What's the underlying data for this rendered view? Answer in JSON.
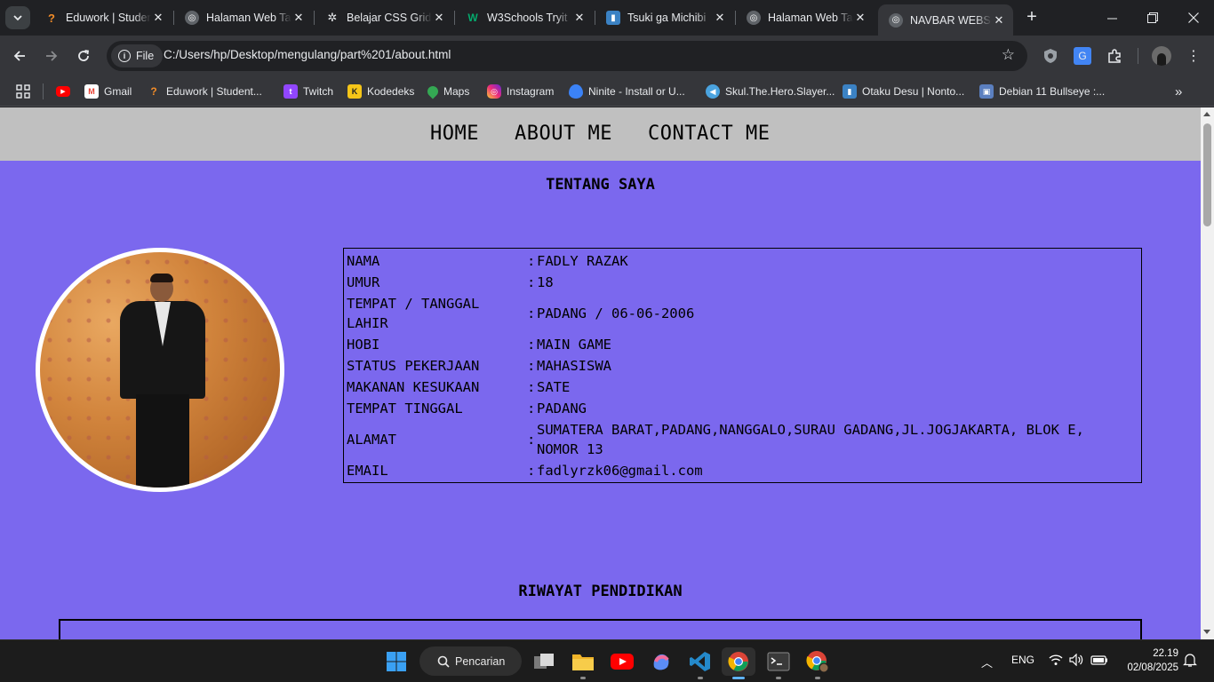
{
  "browser": {
    "tabs": [
      {
        "title": "Eduwork | Student",
        "favicon": "eduwork-icon",
        "active": false
      },
      {
        "title": "Halaman Web Ta",
        "favicon": "globe-icon",
        "active": false
      },
      {
        "title": "Belajar CSS Grid",
        "favicon": "openai-icon",
        "active": false
      },
      {
        "title": "W3Schools Tryit",
        "favicon": "w3schools-icon",
        "active": false
      },
      {
        "title": "Tsuki ga Michibi",
        "favicon": "bookmark-page-icon",
        "active": false
      },
      {
        "title": "Halaman Web Ta",
        "favicon": "globe-icon",
        "active": false
      },
      {
        "title": "NAVBAR WEBSITE",
        "favicon": "globe-icon",
        "active": true
      }
    ],
    "file_chip": "File",
    "url": "C:/Users/hp/Desktop/mengulang/part%201/about.html",
    "bookmarks": [
      {
        "label": "",
        "icon": "youtube-icon"
      },
      {
        "label": "Gmail",
        "icon": "gmail-icon"
      },
      {
        "label": "Eduwork | Student...",
        "icon": "eduwork-icon"
      },
      {
        "label": "Twitch",
        "icon": "twitch-icon"
      },
      {
        "label": "Kodedeks",
        "icon": "kodedeks-icon"
      },
      {
        "label": "Maps",
        "icon": "maps-icon"
      },
      {
        "label": "Instagram",
        "icon": "instagram-icon"
      },
      {
        "label": "Ninite - Install or U...",
        "icon": "ninite-icon"
      },
      {
        "label": "Skul.The.Hero.Slayer...",
        "icon": "skul-icon"
      },
      {
        "label": "Otaku Desu | Nonto...",
        "icon": "otakudesu-icon"
      },
      {
        "label": "Debian 11 Bullseye :...",
        "icon": "debian-icon"
      }
    ]
  },
  "page": {
    "nav": [
      "HOME",
      "ABOUT ME",
      "CONTACT ME"
    ],
    "title": "TENTANG SAYA",
    "bio": [
      {
        "key": "NAMA",
        "value": "FADLY RAZAK"
      },
      {
        "key": "UMUR",
        "value": "18"
      },
      {
        "key": "TEMPAT / TANGGAL LAHIR",
        "value": "PADANG / 06-06-2006"
      },
      {
        "key": "HOBI",
        "value": "MAIN GAME"
      },
      {
        "key": "STATUS PEKERJAAN",
        "value": "MAHASISWA"
      },
      {
        "key": "MAKANAN KESUKAAN",
        "value": "SATE"
      },
      {
        "key": "TEMPAT TINGGAL",
        "value": "PADANG"
      },
      {
        "key": "ALAMAT",
        "value": "SUMATERA BARAT,PADANG,NANGGALO,SURAU GADANG,JL.JOGJAKARTA, BLOK E, NOMOR 13"
      },
      {
        "key": "EMAIL",
        "value": "fadlyrzk06@gmail.com"
      }
    ],
    "separator": ":",
    "education_title": "RIWAYAT PENDIDIKAN"
  },
  "taskbar": {
    "search_label": "Pencarian",
    "language": "ENG",
    "time": "22.19",
    "date": "02/08/2025"
  },
  "colors": {
    "page_background": "#7b68ee",
    "navbar_background": "#c0c0c0"
  }
}
